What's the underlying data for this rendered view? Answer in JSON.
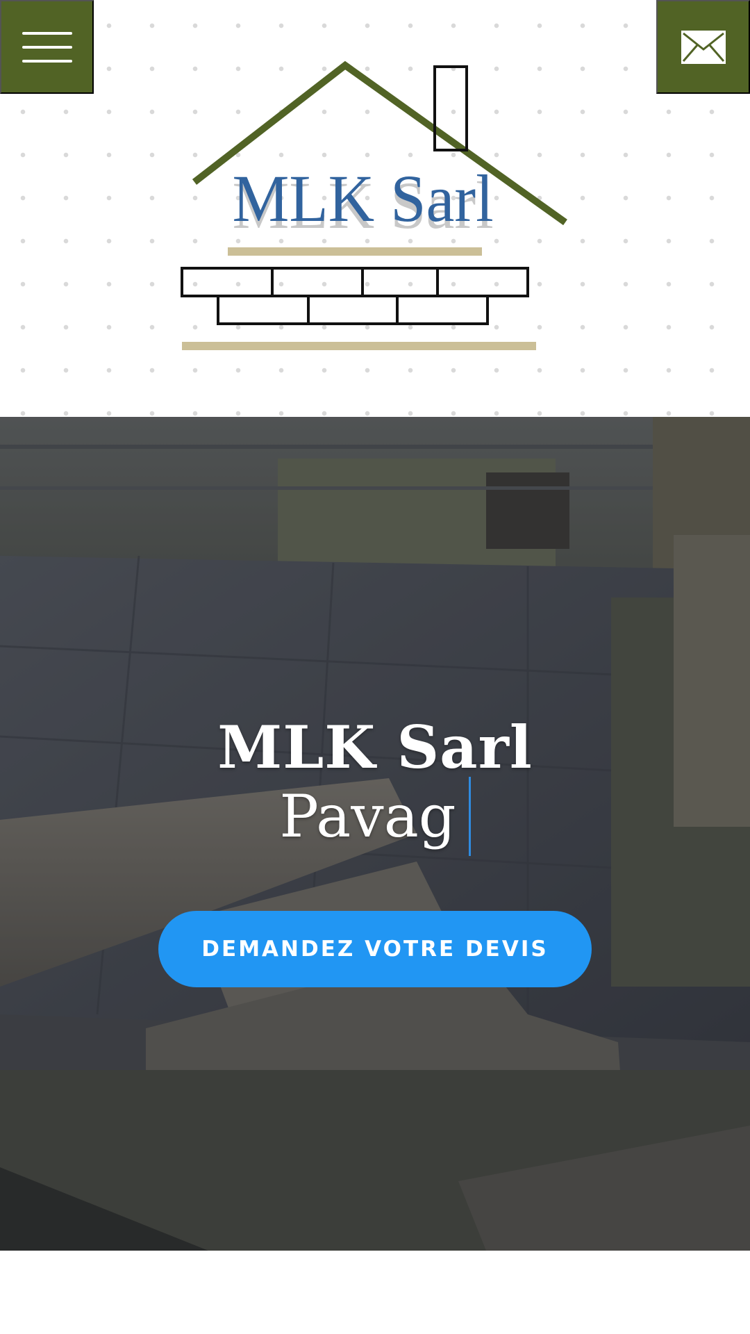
{
  "header": {
    "menu_icon": "hamburger-icon",
    "mail_icon": "envelope-icon",
    "logo_text": "MLK Sarl",
    "colors": {
      "brand_green": "#516325",
      "logo_blue": "#31639e",
      "logo_sand": "#cbbf97"
    }
  },
  "hero": {
    "title": "MLK Sarl",
    "typed_text": "Pavag",
    "cta_label": "DEMANDEZ VOTRE DEVIS",
    "colors": {
      "cta_background": "#2196f3",
      "cursor": "#2f8be0"
    }
  }
}
